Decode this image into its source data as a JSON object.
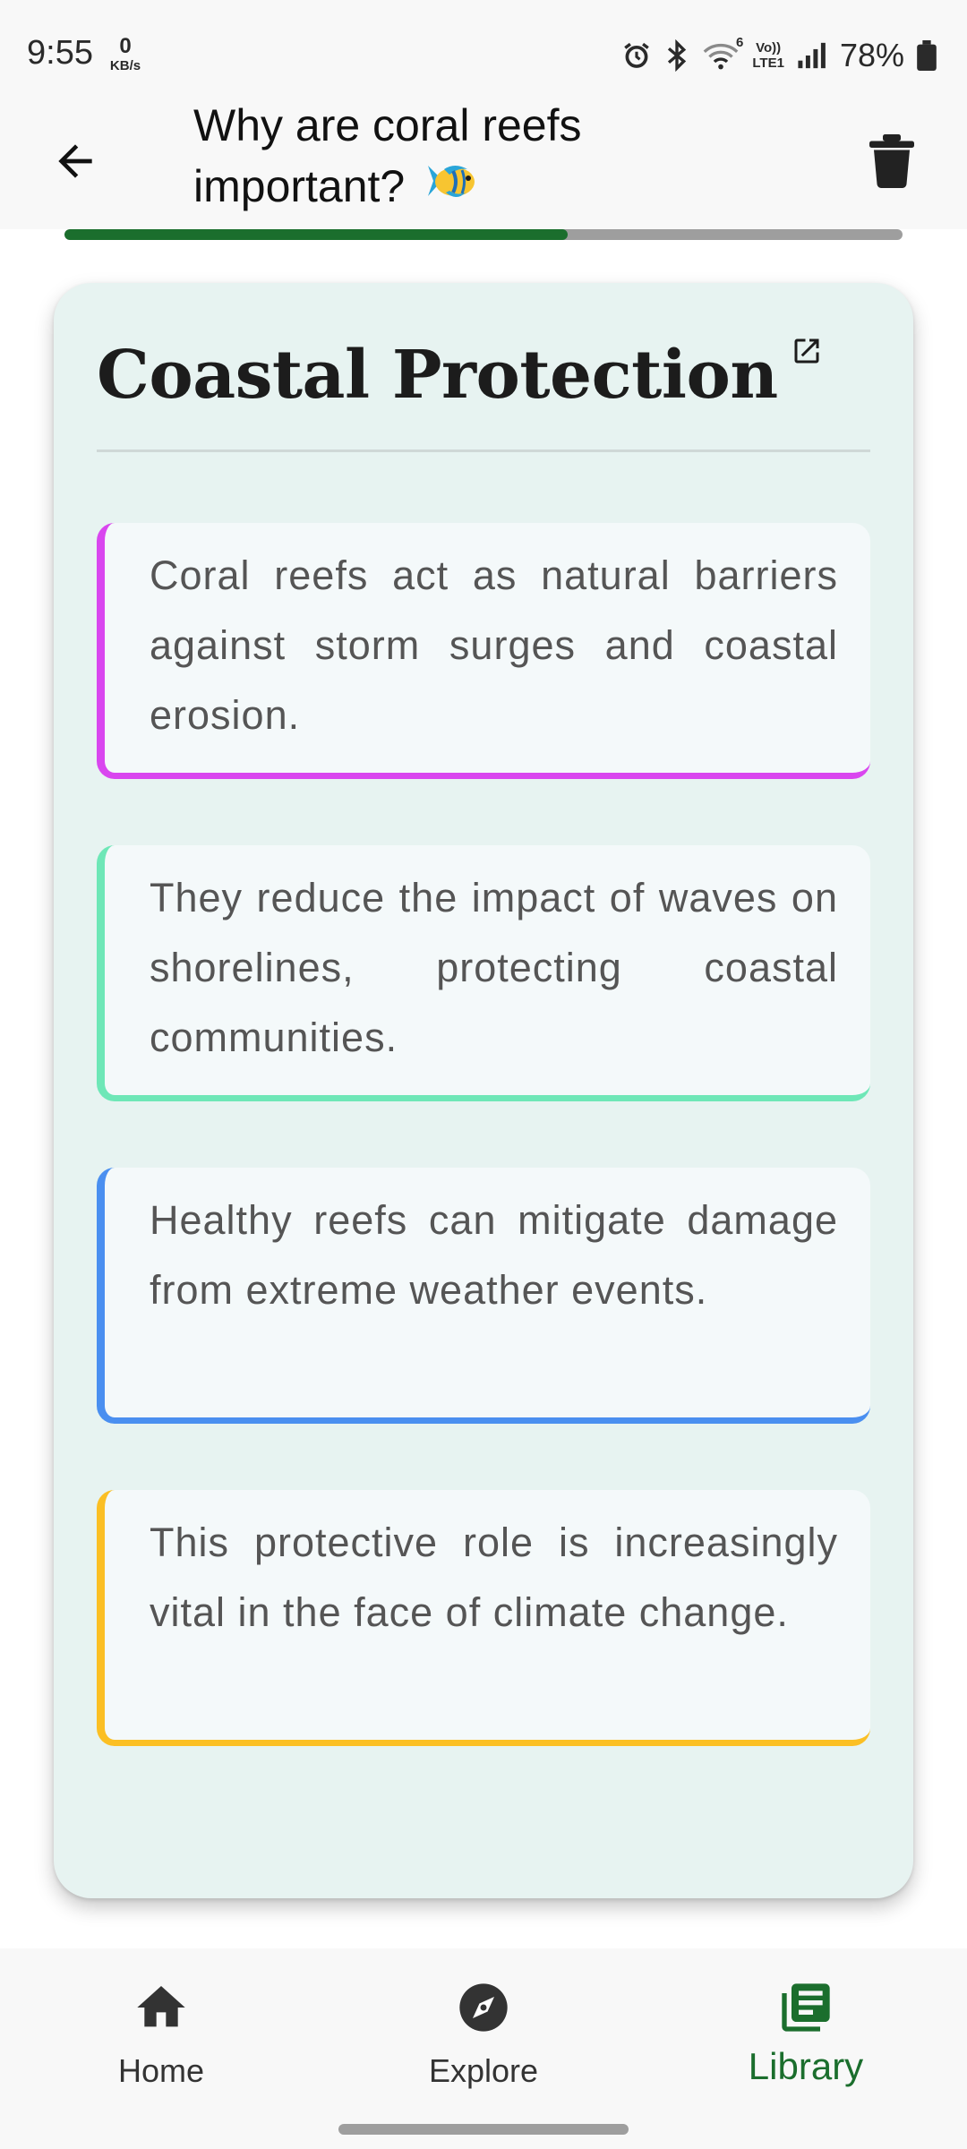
{
  "status_bar": {
    "time": "9:55",
    "net_speed_value": "0",
    "net_speed_unit": "KB/s",
    "volte_label_top": "Vo))",
    "volte_label_bottom": "LTE1",
    "wifi_badge": "6",
    "battery_percent": "78%",
    "icons": [
      "alarm-icon",
      "bluetooth-icon",
      "wifi-icon",
      "volte-icon",
      "signal-icon",
      "battery-icon"
    ]
  },
  "header": {
    "title": "Why are coral reefs important?",
    "back_icon": "arrow-left-icon",
    "delete_icon": "trash-icon",
    "title_emoji_icon": "tropical-fish-icon"
  },
  "progress": {
    "fraction": 0.6
  },
  "card": {
    "title": "Coastal Protection",
    "title_link_icon": "open-in-new-icon",
    "points": [
      {
        "text": "Coral reefs act as natural barriers against storm surges and coastal erosion.",
        "accent": "#d946ef"
      },
      {
        "text": "They reduce the impact of waves on shorelines, protecting coastal communities.",
        "accent": "#6ee7b7"
      },
      {
        "text": "Healthy reefs can mitigate damage from extreme weather events.",
        "accent": "#4a8ff0"
      },
      {
        "text": "This protective role is increasingly vital in the face of climate change.",
        "accent": "#fbbf24"
      }
    ]
  },
  "bottom_nav": {
    "items": [
      {
        "label": "Home",
        "icon": "home-icon",
        "active": false
      },
      {
        "label": "Explore",
        "icon": "compass-icon",
        "active": false
      },
      {
        "label": "Library",
        "icon": "library-icon",
        "active": true
      }
    ]
  },
  "colors": {
    "accent_green": "#1b6e2d",
    "card_background": "#e7f3f1",
    "point_background": "#f4f9fa"
  }
}
